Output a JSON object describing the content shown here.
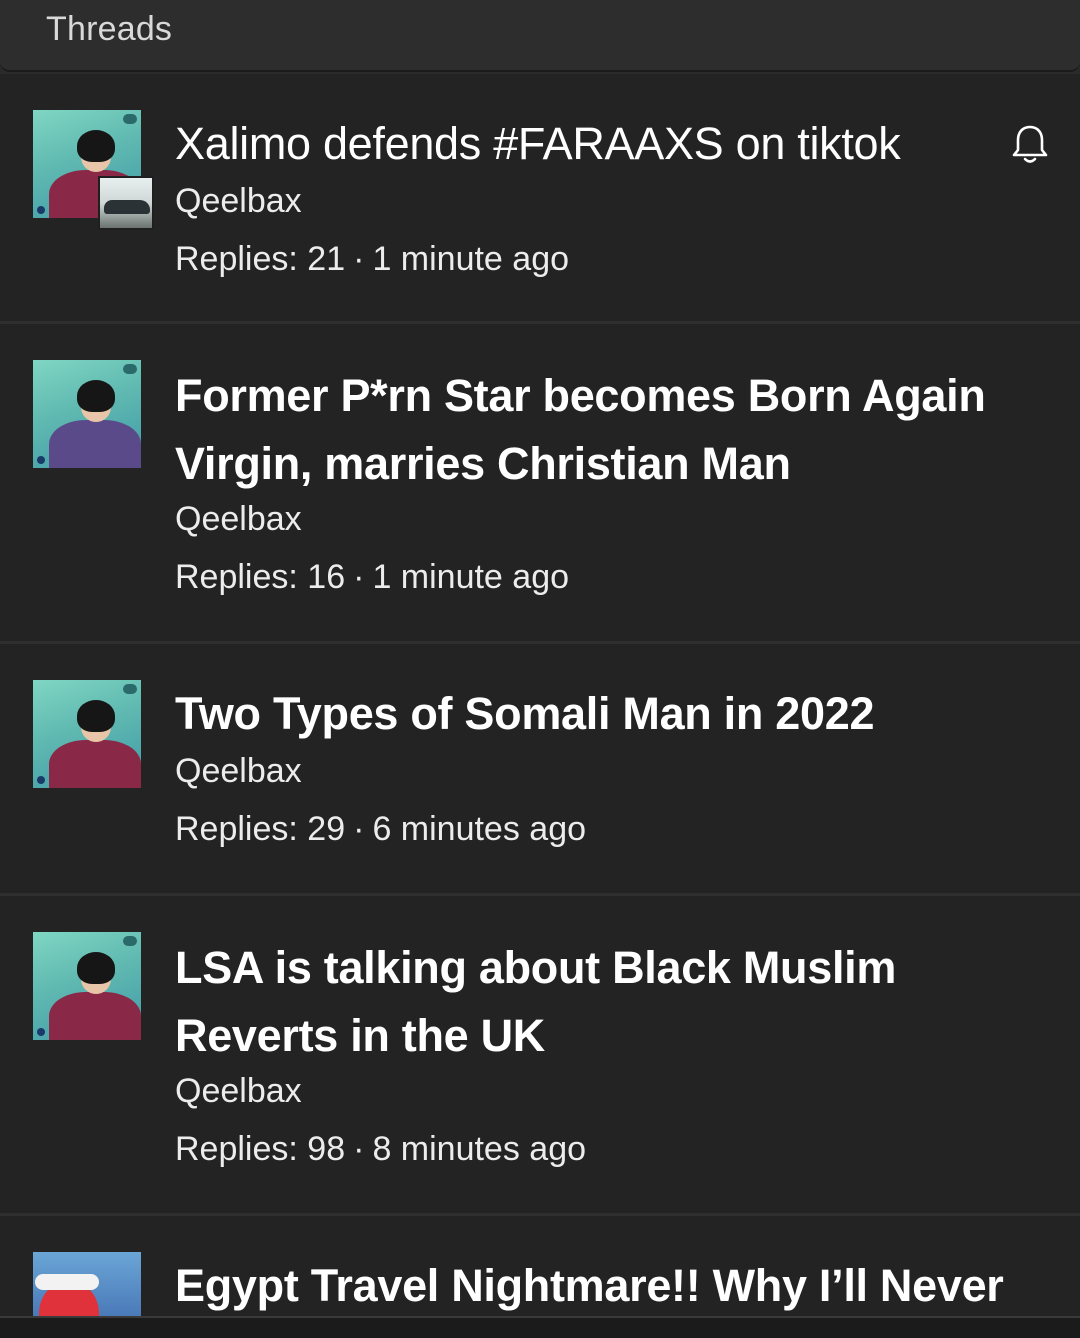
{
  "header": {
    "title": "Threads"
  },
  "threads": [
    {
      "title": "Xalimo defends #FARAAXS on tiktok",
      "author": "Qeelbax",
      "replies": "Replies: 21",
      "time": "1 minute ago",
      "icon": "bell-icon"
    },
    {
      "title": "Former P*rn Star becomes Born Again Virgin, marries Christian Man",
      "author": "Qeelbax",
      "replies": "Replies: 16",
      "time": "1 minute ago"
    },
    {
      "title": "Two Types of Somali Man in 2022",
      "author": "Qeelbax",
      "replies": "Replies: 29",
      "time": "6 minutes ago"
    },
    {
      "title": "LSA is talking about Black Muslim Reverts in the UK",
      "author": "Qeelbax",
      "replies": "Replies: 98",
      "time": "8 minutes ago"
    },
    {
      "title": "Egypt Travel Nightmare!! Why I’ll Never"
    }
  ],
  "separator": "·"
}
